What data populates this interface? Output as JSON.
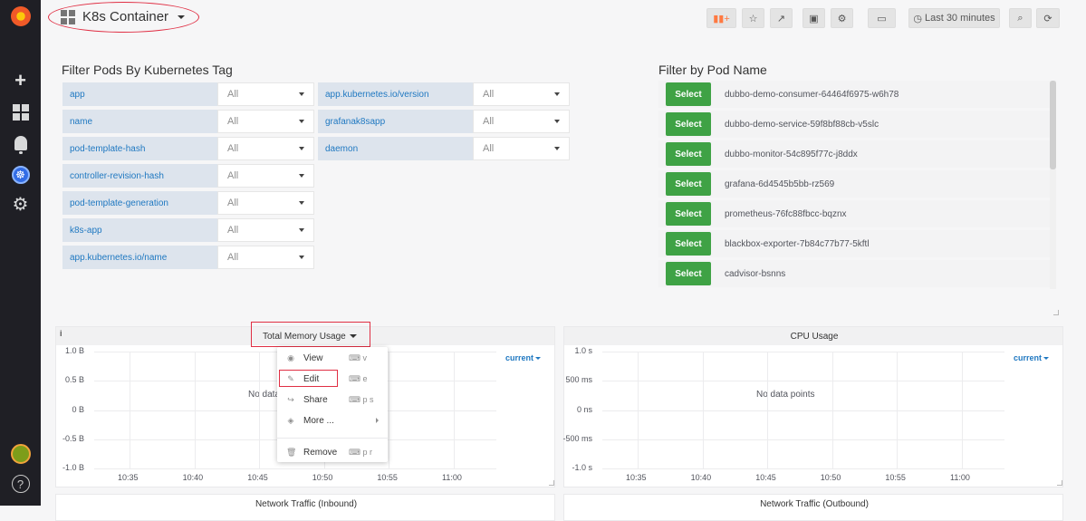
{
  "dashboard": {
    "title": "K8s Container"
  },
  "toolbar": {
    "time_range": "Last 30 minutes"
  },
  "filter_tags": {
    "title": "Filter Pods By Kubernetes Tag",
    "left": [
      {
        "label": "app",
        "value": "All"
      },
      {
        "label": "name",
        "value": "All"
      },
      {
        "label": "pod-template-hash",
        "value": "All"
      },
      {
        "label": "controller-revision-hash",
        "value": "All"
      },
      {
        "label": "pod-template-generation",
        "value": "All"
      },
      {
        "label": "k8s-app",
        "value": "All"
      },
      {
        "label": "app.kubernetes.io/name",
        "value": "All"
      }
    ],
    "right": [
      {
        "label": "app.kubernetes.io/version",
        "value": "All"
      },
      {
        "label": "grafanak8sapp",
        "value": "All"
      },
      {
        "label": "daemon",
        "value": "All"
      }
    ]
  },
  "pod_filter": {
    "title": "Filter by Pod Name",
    "select_label": "Select",
    "pods": [
      "dubbo-demo-consumer-64464f6975-w6h78",
      "dubbo-demo-service-59f8bf88cb-v5slc",
      "dubbo-monitor-54c895f77c-j8ddx",
      "grafana-6d4545b5bb-rz569",
      "prometheus-76fc88fbcc-bqznx",
      "blackbox-exporter-7b84c77b77-5kftl",
      "cadvisor-bsnns"
    ]
  },
  "memory_panel": {
    "info": "i",
    "title": "Total Memory Usage",
    "legend": "current",
    "no_data": "No data points",
    "y_ticks": [
      "1.0 B",
      "0.5 B",
      "0 B",
      "-0.5 B",
      "-1.0 B"
    ],
    "x_ticks": [
      "10:35",
      "10:40",
      "10:45",
      "10:50",
      "10:55",
      "11:00"
    ]
  },
  "cpu_panel": {
    "title": "CPU Usage",
    "legend": "current",
    "no_data": "No data points",
    "y_ticks": [
      "1.0 s",
      "500 ms",
      "0 ns",
      "-500 ms",
      "-1.0 s"
    ],
    "x_ticks": [
      "10:35",
      "10:40",
      "10:45",
      "10:50",
      "10:55",
      "11:00"
    ]
  },
  "panel_menu": {
    "items": [
      {
        "label": "View",
        "shortcut": "v"
      },
      {
        "label": "Edit",
        "shortcut": "e"
      },
      {
        "label": "Share",
        "shortcut": "p s"
      },
      {
        "label": "More ...",
        "shortcut": ""
      },
      {
        "label": "Remove",
        "shortcut": "p r"
      }
    ]
  },
  "bottom_panels": [
    {
      "title": "Network Traffic (Inbound)"
    },
    {
      "title": "Network Traffic (Outbound)"
    }
  ]
}
